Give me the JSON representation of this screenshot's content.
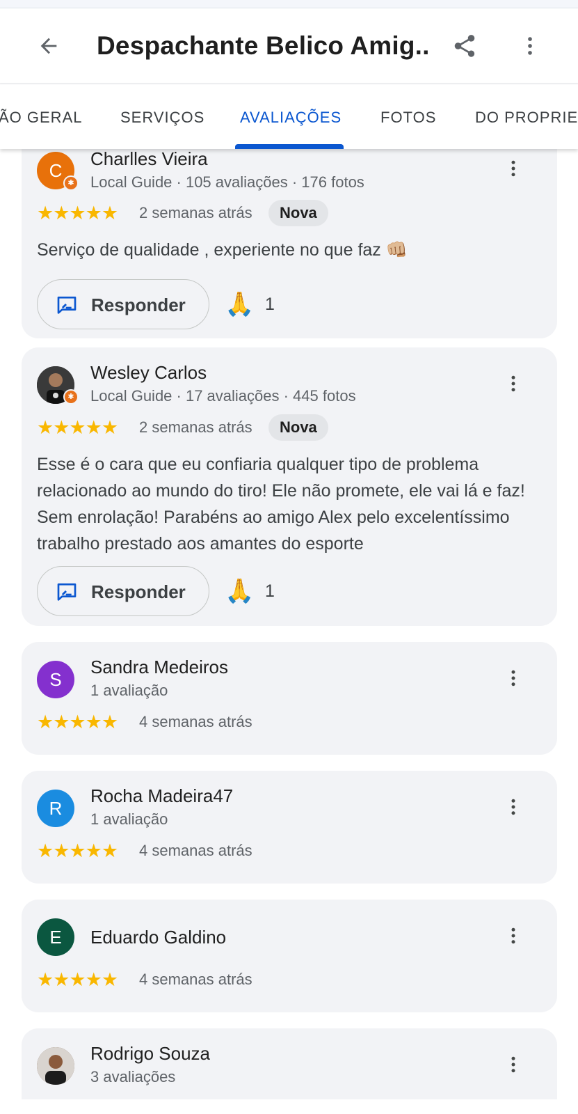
{
  "header": {
    "title": "Despachante Belico Amig...",
    "back_icon": "arrow-back-icon",
    "share_icon": "share-icon",
    "more_icon": "more-vert-icon"
  },
  "tabs": [
    {
      "label": "ÃO GERAL"
    },
    {
      "label": "SERVIÇOS"
    },
    {
      "label": "AVALIAÇÕES",
      "active": true
    },
    {
      "label": "FOTOS"
    },
    {
      "label": "DO PROPRIET"
    }
  ],
  "colors": {
    "accent": "#0b57d0",
    "star": "#f9b700",
    "local_guide_badge": "#e8711a"
  },
  "reviews": [
    {
      "initial": "C",
      "avatar_color": "#e8710a",
      "name": "Charlles Vieira",
      "meta": "Local Guide · 105 avaliações · 176 fotos",
      "rating": 5,
      "stars": "★★★★★",
      "when": "2 semanas atrás",
      "chip": "Nova",
      "text": "Serviço de qualidade , experiente no que faz 👊🏼",
      "reply_label": "Responder",
      "reaction": "🙏",
      "reaction_count": "1"
    },
    {
      "initial": "",
      "avatar_color": "#2b2b2b",
      "name": "Wesley Carlos",
      "meta": "Local Guide · 17 avaliações · 445 fotos",
      "rating": 5,
      "stars": "★★★★★",
      "when": "2 semanas atrás",
      "chip": "Nova",
      "text": "Esse é o cara que eu confiaria qualquer tipo de problema relacionado ao mundo do tiro! Ele não promete, ele vai lá e faz! Sem enrolação! Parabéns ao amigo Alex pelo excelentíssimo trabalho prestado aos amantes do esporte",
      "reply_label": "Responder",
      "reaction": "🙏",
      "reaction_count": "1"
    },
    {
      "initial": "S",
      "avatar_color": "#8430ce",
      "name": "Sandra Medeiros",
      "meta": "1 avaliação",
      "rating": 5,
      "stars": "★★★★★",
      "when": "4 semanas atrás"
    },
    {
      "initial": "R",
      "avatar_color": "#1a8ce0",
      "name": "Rocha Madeira47",
      "meta": "1 avaliação",
      "rating": 5,
      "stars": "★★★★★",
      "when": "4 semanas atrás"
    },
    {
      "initial": "E",
      "avatar_color": "#0b5740",
      "name": "Eduardo Galdino",
      "rating": 5,
      "stars": "★★★★★",
      "when": "4 semanas atrás"
    },
    {
      "initial": "",
      "avatar_color": "#6b4a3a",
      "name": "Rodrigo Souza",
      "meta": "3 avaliações"
    }
  ]
}
